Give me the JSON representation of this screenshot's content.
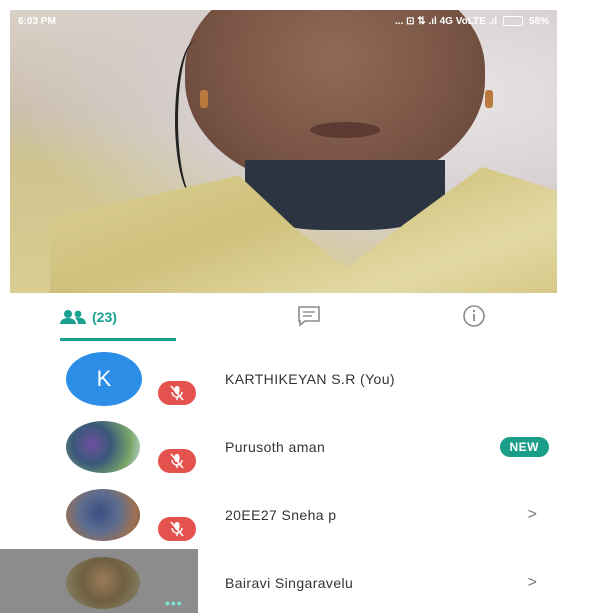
{
  "status_bar": {
    "time": "6:03 PM",
    "icons": "... ⊡ ⇅ .ıl 4G VoLTE .ıl",
    "battery": "58%"
  },
  "tabs": {
    "people_count": "(23)",
    "people_icon": "people-icon",
    "chat_icon": "chat-icon",
    "info_icon": "info-icon"
  },
  "participants": [
    {
      "avatar_letter": "K",
      "name": "KARTHIKEYAN S.R (You)",
      "muted": true
    },
    {
      "name": "Purusoth aman",
      "badge": "NEW",
      "muted": true
    },
    {
      "name": "20EE27 Sneha p",
      "chevron": ">",
      "muted": true
    },
    {
      "name": "Bairavi Singaravelu",
      "chevron": ">",
      "more": "•••"
    }
  ],
  "colors": {
    "accent": "#1aa08f",
    "mute": "#e4524e",
    "avatar_blue": "#2d8ee8"
  }
}
